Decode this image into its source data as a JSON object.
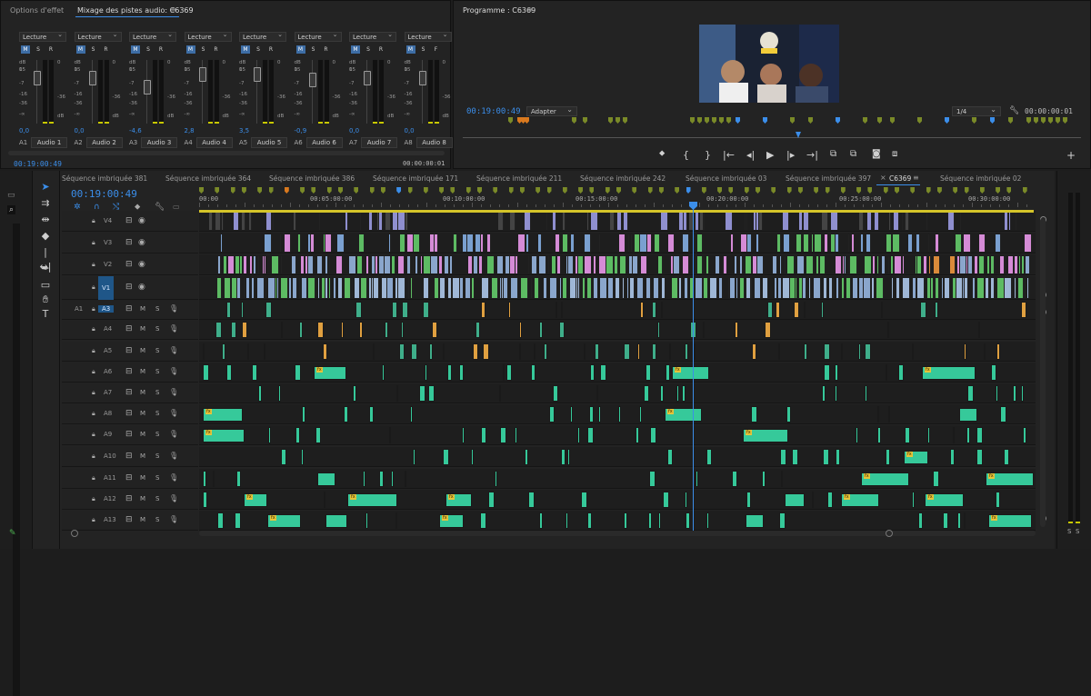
{
  "effect_panel": {
    "tabs": [
      "Options d'effet",
      "Mixage des pistes audio: C6369"
    ],
    "tab_menu": "≡",
    "scale_labels": [
      "dB",
      "15",
      "0",
      "-7",
      "-16",
      "-36",
      "-∞"
    ],
    "meter_scale": [
      "0",
      "-36",
      "dB"
    ],
    "timecode_left": "00:19:00:49",
    "timecode_right": "00:00:00:01",
    "channels": [
      {
        "mode": "Lecture",
        "value": "0,0",
        "name": "A1",
        "button": "Audio 1"
      },
      {
        "mode": "Lecture",
        "value": "0,0",
        "name": "A2",
        "button": "Audio 2"
      },
      {
        "mode": "Lecture",
        "value": "-4,6",
        "name": "A3",
        "button": "Audio 3"
      },
      {
        "mode": "Lecture",
        "value": "2,8",
        "name": "A4",
        "button": "Audio 4"
      },
      {
        "mode": "Lecture",
        "value": "3,5",
        "name": "A5",
        "button": "Audio 5"
      },
      {
        "mode": "Lecture",
        "value": "-0,9",
        "name": "A6",
        "button": "Audio 6"
      },
      {
        "mode": "Lecture",
        "value": "0,0",
        "name": "A7",
        "button": "Audio 7"
      },
      {
        "mode": "Lecture",
        "value": "0,0",
        "name": "A8",
        "button": "Audio 8"
      }
    ]
  },
  "program": {
    "title": "Programme : C6369",
    "menu_icon": "≡",
    "timecode": "00:19:00:49",
    "fit": "Adapter",
    "resolution": "1/4",
    "duration": "00:00:00:01"
  },
  "timeline": {
    "tabs": [
      "Séquence imbriquée 381",
      "Séquence imbriquée 364",
      "Séquence imbriquée 386",
      "Séquence imbriquée 171",
      "Séquence imbriquée 211",
      "Séquence imbriquée 242",
      "Séquence imbriquée 03",
      "Séquence imbriquée 397",
      "C6369",
      "Séquence imbriquée 02"
    ],
    "active_close": "×",
    "tab_menu": "≡",
    "timecode": "00:19:00:49",
    "ruler": [
      "00:00",
      "00:05:00:00",
      "00:10:00:00",
      "00:15:00:00",
      "00:20:00:00",
      "00:25:00:00",
      "00:30:00:00"
    ],
    "video_tracks": [
      "V4",
      "V3",
      "V2",
      "V1"
    ],
    "audio_tracks": [
      "A3",
      "A4",
      "A5",
      "A6",
      "A7",
      "A8",
      "A9",
      "A10",
      "A11",
      "A12",
      "A13"
    ],
    "source_patch": "A1",
    "ms": [
      "M",
      "S"
    ],
    "meter_ss": [
      "S",
      "S"
    ],
    "fx_label": "fx"
  },
  "colors": {
    "accent": "#3b8eea",
    "clip_teal": "#36c99a",
    "clip_pink": "#d58bd6",
    "clip_blue": "#8aa6cc",
    "clip_green": "#5dbb63",
    "clip_orange": "#e0a040",
    "marker": "#7a8a28"
  }
}
